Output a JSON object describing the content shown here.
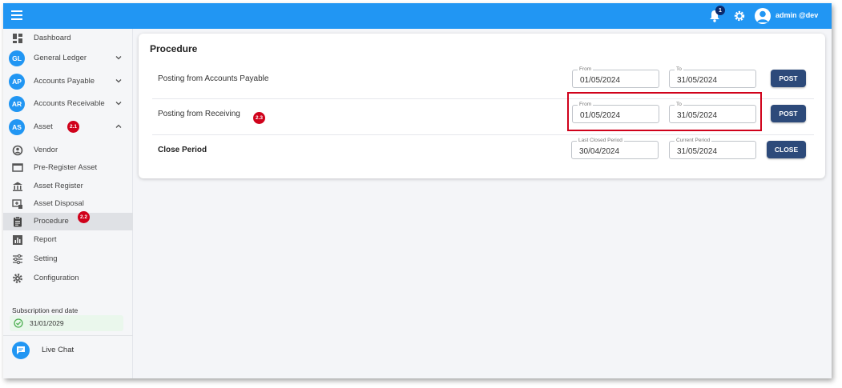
{
  "user": {
    "name": "admin @dev",
    "notifications": "1"
  },
  "colors": {
    "topbar": "#2196f3",
    "button": "#2d4a7a",
    "badge": "#d0021b",
    "highlight": "#d0021b"
  },
  "sidebar": {
    "items": [
      {
        "label": "Dashboard",
        "icon": "dashboard-icon"
      },
      {
        "label": "General Ledger",
        "abbr": "GL",
        "expandable": "chevron-down"
      },
      {
        "label": "Accounts Payable",
        "abbr": "AP",
        "expandable": "chevron-down"
      },
      {
        "label": "Accounts Receivable",
        "abbr": "AR",
        "expandable": "chevron-down"
      },
      {
        "label": "Asset",
        "abbr": "AS",
        "expandable": "chevron-up",
        "step": "2.1"
      },
      {
        "label": "Vendor",
        "icon": "vendor-icon"
      },
      {
        "label": "Pre-Register Asset",
        "icon": "monitor-icon"
      },
      {
        "label": "Asset Register",
        "icon": "bank-icon"
      },
      {
        "label": "Asset Disposal",
        "icon": "disposal-icon"
      },
      {
        "label": "Procedure",
        "icon": "clipboard-icon",
        "step": "2.2",
        "active": "true"
      },
      {
        "label": "Report",
        "icon": "report-icon"
      },
      {
        "label": "Setting",
        "icon": "sliders-icon"
      },
      {
        "label": "Configuration",
        "icon": "gear-icon"
      }
    ],
    "subscription": {
      "label": "Subscription end date",
      "date": "31/01/2029"
    },
    "chat": {
      "label": "Live Chat"
    }
  },
  "procedure": {
    "title": "Procedure",
    "rows": [
      {
        "label": "Posting from Accounts Payable",
        "from_legend": "From",
        "from": "01/05/2024",
        "to_legend": "To",
        "to": "31/05/2024",
        "button": "POST"
      },
      {
        "label": "Posting from Receiving",
        "step": "2.3",
        "from_legend": "From",
        "from": "01/05/2024",
        "to_legend": "To",
        "to": "31/05/2024",
        "button": "POST"
      },
      {
        "label": "Close Period",
        "from_legend": "Last Closed Period",
        "from": "30/04/2024",
        "to_legend": "Current Period",
        "to": "31/05/2024",
        "button": "CLOSE"
      }
    ]
  }
}
